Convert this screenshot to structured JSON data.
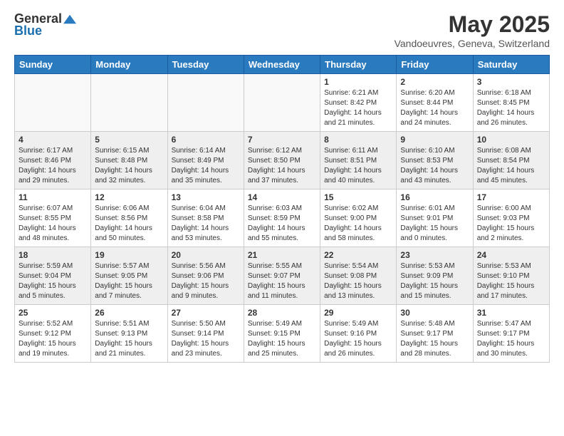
{
  "header": {
    "logo_general": "General",
    "logo_blue": "Blue",
    "month_year": "May 2025",
    "location": "Vandoeuvres, Geneva, Switzerland"
  },
  "days_of_week": [
    "Sunday",
    "Monday",
    "Tuesday",
    "Wednesday",
    "Thursday",
    "Friday",
    "Saturday"
  ],
  "weeks": [
    [
      {
        "day": "",
        "info": ""
      },
      {
        "day": "",
        "info": ""
      },
      {
        "day": "",
        "info": ""
      },
      {
        "day": "",
        "info": ""
      },
      {
        "day": "1",
        "info": "Sunrise: 6:21 AM\nSunset: 8:42 PM\nDaylight: 14 hours\nand 21 minutes."
      },
      {
        "day": "2",
        "info": "Sunrise: 6:20 AM\nSunset: 8:44 PM\nDaylight: 14 hours\nand 24 minutes."
      },
      {
        "day": "3",
        "info": "Sunrise: 6:18 AM\nSunset: 8:45 PM\nDaylight: 14 hours\nand 26 minutes."
      }
    ],
    [
      {
        "day": "4",
        "info": "Sunrise: 6:17 AM\nSunset: 8:46 PM\nDaylight: 14 hours\nand 29 minutes."
      },
      {
        "day": "5",
        "info": "Sunrise: 6:15 AM\nSunset: 8:48 PM\nDaylight: 14 hours\nand 32 minutes."
      },
      {
        "day": "6",
        "info": "Sunrise: 6:14 AM\nSunset: 8:49 PM\nDaylight: 14 hours\nand 35 minutes."
      },
      {
        "day": "7",
        "info": "Sunrise: 6:12 AM\nSunset: 8:50 PM\nDaylight: 14 hours\nand 37 minutes."
      },
      {
        "day": "8",
        "info": "Sunrise: 6:11 AM\nSunset: 8:51 PM\nDaylight: 14 hours\nand 40 minutes."
      },
      {
        "day": "9",
        "info": "Sunrise: 6:10 AM\nSunset: 8:53 PM\nDaylight: 14 hours\nand 43 minutes."
      },
      {
        "day": "10",
        "info": "Sunrise: 6:08 AM\nSunset: 8:54 PM\nDaylight: 14 hours\nand 45 minutes."
      }
    ],
    [
      {
        "day": "11",
        "info": "Sunrise: 6:07 AM\nSunset: 8:55 PM\nDaylight: 14 hours\nand 48 minutes."
      },
      {
        "day": "12",
        "info": "Sunrise: 6:06 AM\nSunset: 8:56 PM\nDaylight: 14 hours\nand 50 minutes."
      },
      {
        "day": "13",
        "info": "Sunrise: 6:04 AM\nSunset: 8:58 PM\nDaylight: 14 hours\nand 53 minutes."
      },
      {
        "day": "14",
        "info": "Sunrise: 6:03 AM\nSunset: 8:59 PM\nDaylight: 14 hours\nand 55 minutes."
      },
      {
        "day": "15",
        "info": "Sunrise: 6:02 AM\nSunset: 9:00 PM\nDaylight: 14 hours\nand 58 minutes."
      },
      {
        "day": "16",
        "info": "Sunrise: 6:01 AM\nSunset: 9:01 PM\nDaylight: 15 hours\nand 0 minutes."
      },
      {
        "day": "17",
        "info": "Sunrise: 6:00 AM\nSunset: 9:03 PM\nDaylight: 15 hours\nand 2 minutes."
      }
    ],
    [
      {
        "day": "18",
        "info": "Sunrise: 5:59 AM\nSunset: 9:04 PM\nDaylight: 15 hours\nand 5 minutes."
      },
      {
        "day": "19",
        "info": "Sunrise: 5:57 AM\nSunset: 9:05 PM\nDaylight: 15 hours\nand 7 minutes."
      },
      {
        "day": "20",
        "info": "Sunrise: 5:56 AM\nSunset: 9:06 PM\nDaylight: 15 hours\nand 9 minutes."
      },
      {
        "day": "21",
        "info": "Sunrise: 5:55 AM\nSunset: 9:07 PM\nDaylight: 15 hours\nand 11 minutes."
      },
      {
        "day": "22",
        "info": "Sunrise: 5:54 AM\nSunset: 9:08 PM\nDaylight: 15 hours\nand 13 minutes."
      },
      {
        "day": "23",
        "info": "Sunrise: 5:53 AM\nSunset: 9:09 PM\nDaylight: 15 hours\nand 15 minutes."
      },
      {
        "day": "24",
        "info": "Sunrise: 5:53 AM\nSunset: 9:10 PM\nDaylight: 15 hours\nand 17 minutes."
      }
    ],
    [
      {
        "day": "25",
        "info": "Sunrise: 5:52 AM\nSunset: 9:12 PM\nDaylight: 15 hours\nand 19 minutes."
      },
      {
        "day": "26",
        "info": "Sunrise: 5:51 AM\nSunset: 9:13 PM\nDaylight: 15 hours\nand 21 minutes."
      },
      {
        "day": "27",
        "info": "Sunrise: 5:50 AM\nSunset: 9:14 PM\nDaylight: 15 hours\nand 23 minutes."
      },
      {
        "day": "28",
        "info": "Sunrise: 5:49 AM\nSunset: 9:15 PM\nDaylight: 15 hours\nand 25 minutes."
      },
      {
        "day": "29",
        "info": "Sunrise: 5:49 AM\nSunset: 9:16 PM\nDaylight: 15 hours\nand 26 minutes."
      },
      {
        "day": "30",
        "info": "Sunrise: 5:48 AM\nSunset: 9:17 PM\nDaylight: 15 hours\nand 28 minutes."
      },
      {
        "day": "31",
        "info": "Sunrise: 5:47 AM\nSunset: 9:17 PM\nDaylight: 15 hours\nand 30 minutes."
      }
    ]
  ]
}
